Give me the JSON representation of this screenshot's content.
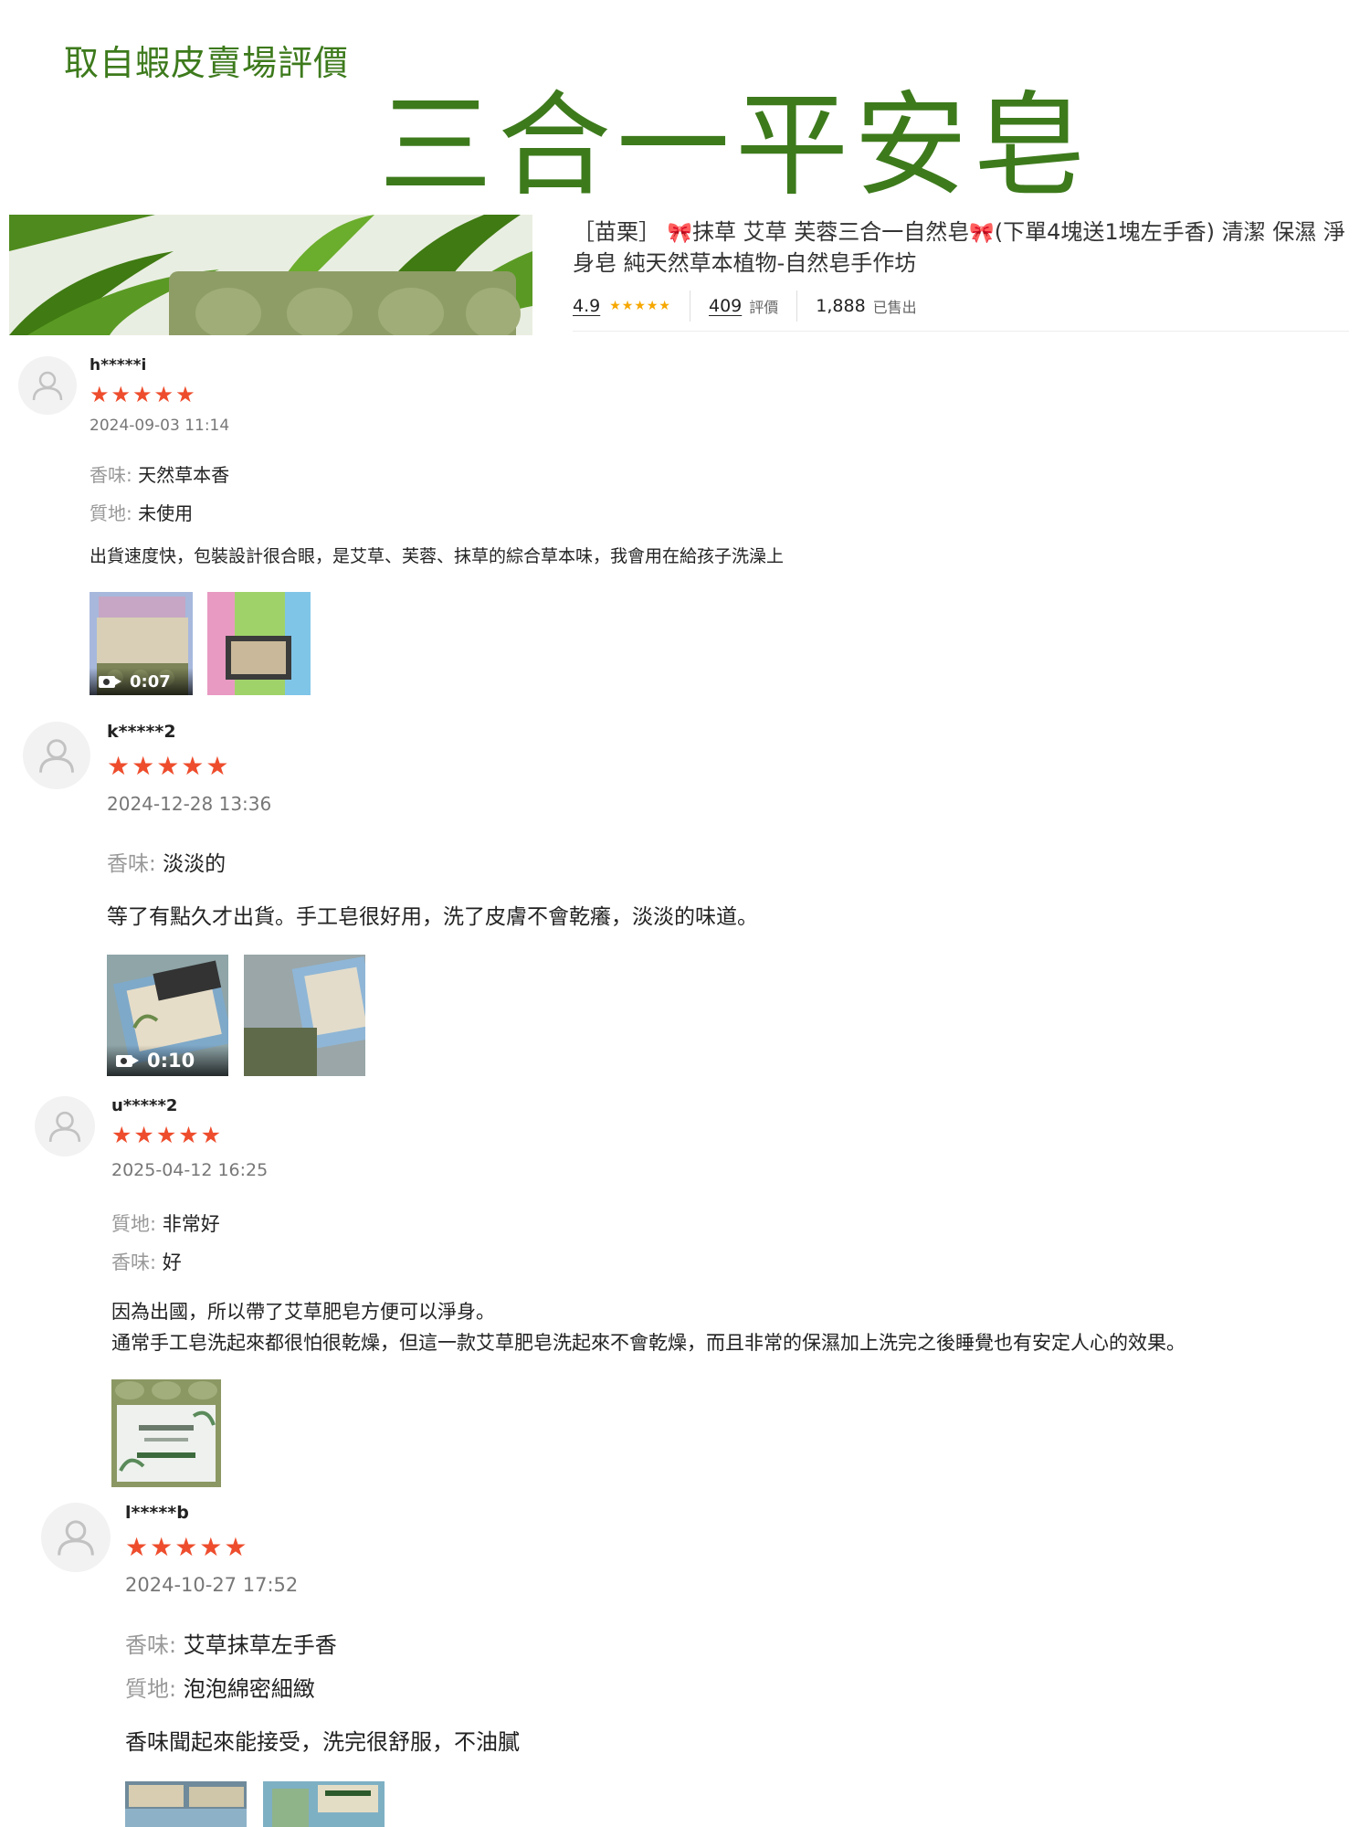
{
  "header": {
    "source_note": "取自蝦皮賣場評價",
    "headline": "三合一平安皂"
  },
  "product": {
    "title_part1": "［苗栗］",
    "title_part2": "抹草 艾草 芙蓉三合一自然皂",
    "title_part3": "(下單4塊送1塊左手香) 清潔 保濕 淨身皂 純天然草本植物-自然皂手作坊",
    "bow_icon": "ribbon-bow-icon",
    "rating": "4.9",
    "review_count": "409",
    "review_label": "評價",
    "sold_count": "1,888",
    "sold_label": "已售出"
  },
  "reviews": [
    {
      "username": "h*****i",
      "stars": "★★★★★",
      "rating": 5,
      "date": "2024-09-03 11:14",
      "attributes": [
        {
          "key": "香味:",
          "value": "天然草本香"
        },
        {
          "key": "質地:",
          "value": "未使用"
        }
      ],
      "comment": "出貨速度快，包裝設計很合眼，是艾草、芙蓉、抹草的綜合草本味，我會用在給孩子洗澡上",
      "video_duration": "0:07"
    },
    {
      "username": "k*****2",
      "stars": "★★★★★",
      "rating": 5,
      "date": "2024-12-28 13:36",
      "attributes": [
        {
          "key": "香味:",
          "value": "淡淡的"
        }
      ],
      "comment": "等了有點久才出貨。手工皂很好用，洗了皮膚不會乾癢，淡淡的味道。",
      "video_duration": "0:10"
    },
    {
      "username": "u*****2",
      "stars": "★★★★★",
      "rating": 5,
      "date": "2025-04-12 16:25",
      "attributes": [
        {
          "key": "質地:",
          "value": "非常好"
        },
        {
          "key": "香味:",
          "value": "好"
        }
      ],
      "comment_line1": "因為出國，所以帶了艾草肥皂方便可以淨身。",
      "comment_line2": "通常手工皂洗起來都很怕很乾燥，但這一款艾草肥皂洗起來不會乾燥，而且非常的保濕加上洗完之後睡覺也有安定人心的效果。"
    },
    {
      "username": "l*****b",
      "stars": "★★★★★",
      "rating": 5,
      "date": "2024-10-27 17:52",
      "attributes": [
        {
          "key": "香味:",
          "value": "艾草抹草左手香"
        },
        {
          "key": "質地:",
          "value": "泡泡綿密細緻"
        }
      ],
      "comment": "香味聞起來能接受，洗完很舒服，不油膩"
    }
  ],
  "colors": {
    "headline_green": "#3d7a1c",
    "star_red": "#ee4d2d",
    "small_star_gold": "#f6a700"
  }
}
